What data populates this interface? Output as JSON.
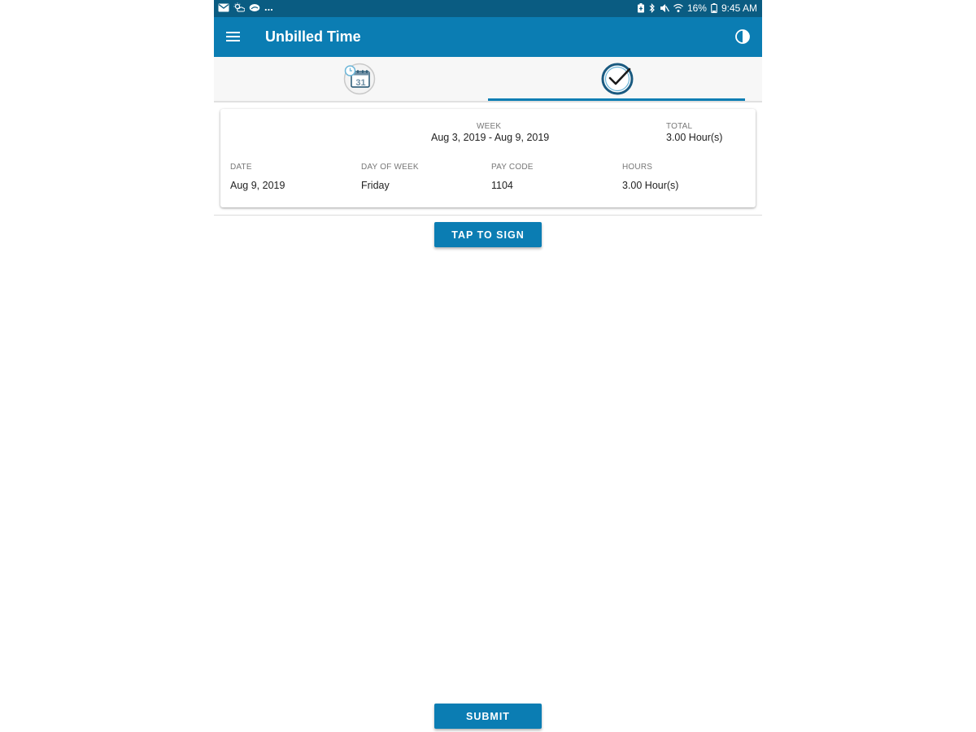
{
  "status_bar": {
    "left_icons": [
      "mail-icon",
      "weather-icon",
      "cloud-icon"
    ],
    "overflow": "...",
    "right_icons": [
      "battery-saver-icon",
      "bluetooth-icon",
      "mute-icon",
      "wifi-icon"
    ],
    "battery": "16%",
    "time": "9:45 AM"
  },
  "app_bar": {
    "title": "Unbilled Time",
    "menu_icon": "hamburger-menu-icon",
    "theme_icon": "contrast-icon"
  },
  "tabs": [
    {
      "icon": "calendar-clock-icon",
      "calendar_day": "31",
      "selected": false
    },
    {
      "icon": "check-circle-icon",
      "selected": true
    }
  ],
  "summary": {
    "week_label": "WEEK",
    "week_value": "Aug 3, 2019 - Aug 9, 2019",
    "total_label": "TOTAL",
    "total_value": "3.00 Hour(s)"
  },
  "columns": [
    "DATE",
    "DAY OF WEEK",
    "PAY CODE",
    "HOURS"
  ],
  "rows": [
    [
      "Aug 9, 2019",
      "Friday",
      "1104",
      "3.00 Hour(s)"
    ]
  ],
  "buttons": {
    "sign_label": "TAP TO SIGN",
    "submit_label": "SUBMIT"
  },
  "colors": {
    "status_bar": "#0a5c82",
    "primary": "#0b7db3",
    "icon_dark": "#1a4d6b"
  }
}
